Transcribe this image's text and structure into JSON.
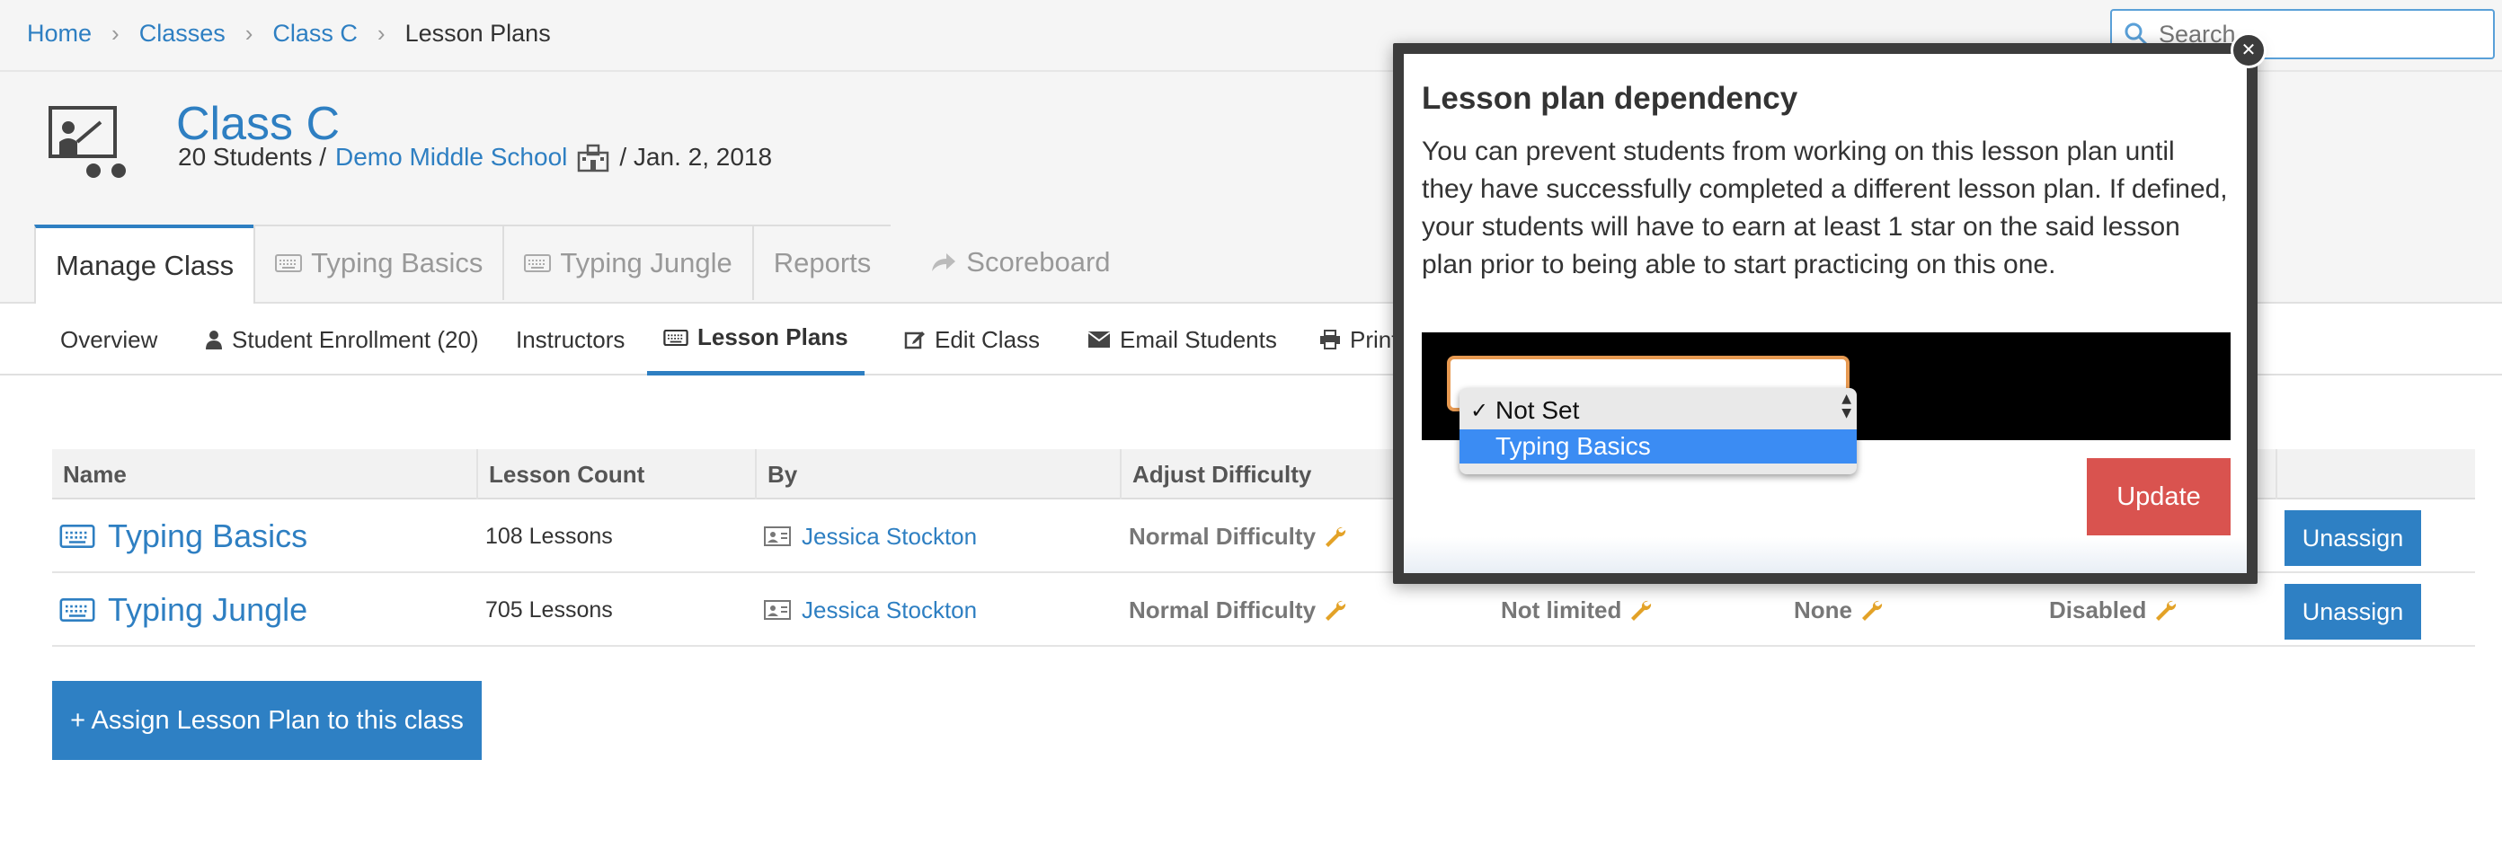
{
  "breadcrumb": {
    "items": [
      "Home",
      "Classes",
      "Class C"
    ],
    "current": "Lesson Plans"
  },
  "search": {
    "placeholder": "Search"
  },
  "header": {
    "title": "Class C",
    "students": "20 Students /",
    "school": "Demo Middle School",
    "date": "/ Jan. 2, 2018"
  },
  "tabs": [
    {
      "label": "Manage Class",
      "icon": ""
    },
    {
      "label": "Typing Basics",
      "icon": "keyboard-icon"
    },
    {
      "label": "Typing Jungle",
      "icon": "keyboard-icon"
    },
    {
      "label": "Reports",
      "icon": ""
    },
    {
      "label": "Scoreboard",
      "icon": "share-icon"
    }
  ],
  "subnav": [
    {
      "label": "Overview"
    },
    {
      "label": "Student Enrollment (20)"
    },
    {
      "label": "Instructors"
    },
    {
      "label": "Lesson Plans"
    },
    {
      "label": "Edit Class"
    },
    {
      "label": "Email Students"
    },
    {
      "label": "Print"
    }
  ],
  "table": {
    "headers": [
      "Name",
      "Lesson Count",
      "By",
      "Adjust Difficulty"
    ],
    "rows": [
      {
        "name": "Typing Basics",
        "count": "108 Lessons",
        "by": "Jessica Stockton",
        "difficulty": "Normal Difficulty",
        "limit": "",
        "dependency": "",
        "status": "",
        "action": "Unassign"
      },
      {
        "name": "Typing Jungle",
        "count": "705 Lessons",
        "by": "Jessica Stockton",
        "difficulty": "Normal Difficulty",
        "limit": "Not limited",
        "dependency": "None",
        "status": "Disabled",
        "action": "Unassign"
      }
    ]
  },
  "assign_button": "+ Assign Lesson Plan to this class",
  "modal": {
    "title": "Lesson plan dependency",
    "body": "You can prevent students from working on this lesson plan until they have successfully completed a different lesson plan. If defined, your students will have to earn at least 1 star on the said lesson plan prior to being able to start practicing on this one.",
    "options": [
      "Not Set",
      "Typing Basics"
    ],
    "selected": "Not Set",
    "highlighted": "Typing Basics",
    "update_button": "Update"
  },
  "colors": {
    "link": "#2e7fc2",
    "primary_button": "#2e80c4",
    "danger_button": "#d9534f",
    "wrench": "#e3a227",
    "highlight": "#3b8cf3"
  }
}
